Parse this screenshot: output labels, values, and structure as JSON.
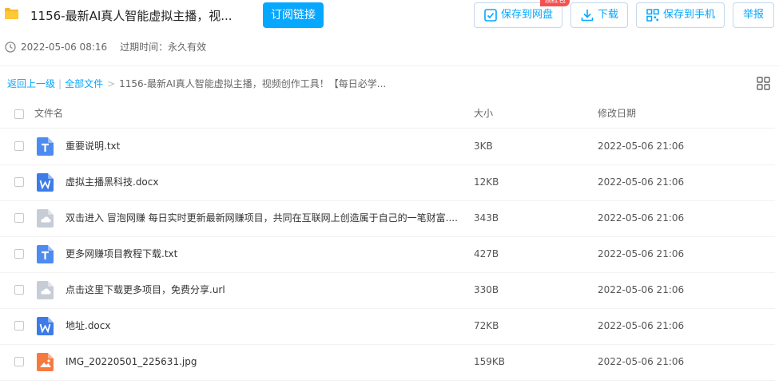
{
  "header": {
    "title": "1156-最新AI真人智能虚拟主播，视...",
    "subscribe_label": "订阅链接",
    "save_netdisk_label": "保存到网盘",
    "badge": "领红包",
    "download_label": "下载",
    "save_phone_label": "保存到手机",
    "report_label": "举报"
  },
  "meta": {
    "share_time": "2022-05-06 08:16",
    "expire": "过期时间：永久有效"
  },
  "breadcrumb": {
    "back": "返回上一级",
    "sep1": "|",
    "all_files": "全部文件",
    "gt": ">",
    "current": "1156-最新AI真人智能虚拟主播，视频创作工具！【每日必学..."
  },
  "columns": {
    "name": "文件名",
    "size": "大小",
    "date": "修改日期"
  },
  "colors": {
    "accent": "#06a7ff",
    "txt": "#4d8bf0",
    "doc": "#3d7be8",
    "other": "#c7cdd6",
    "img": "#f6793f"
  },
  "files": [
    {
      "name": "重要说明.txt",
      "size": "3KB",
      "date": "2022-05-06 21:06",
      "type": "txt-icon"
    },
    {
      "name": "虚拟主播黑科技.docx",
      "size": "12KB",
      "date": "2022-05-06 21:06",
      "type": "docx-icon"
    },
    {
      "name": "双击进入 冒泡网赚 每日实时更新最新网赚项目，共同在互联网上创造属于自己的一笔财富....",
      "size": "343B",
      "date": "2022-05-06 21:06",
      "type": "cloud-file-icon"
    },
    {
      "name": "更多网赚项目教程下载.txt",
      "size": "427B",
      "date": "2022-05-06 21:06",
      "type": "txt-icon"
    },
    {
      "name": "点击这里下载更多项目，免费分享.url",
      "size": "330B",
      "date": "2022-05-06 21:06",
      "type": "cloud-file-icon"
    },
    {
      "name": "地址.docx",
      "size": "72KB",
      "date": "2022-05-06 21:06",
      "type": "docx-icon"
    },
    {
      "name": "IMG_20220501_225631.jpg",
      "size": "159KB",
      "date": "2022-05-06 21:06",
      "type": "image-icon"
    }
  ]
}
